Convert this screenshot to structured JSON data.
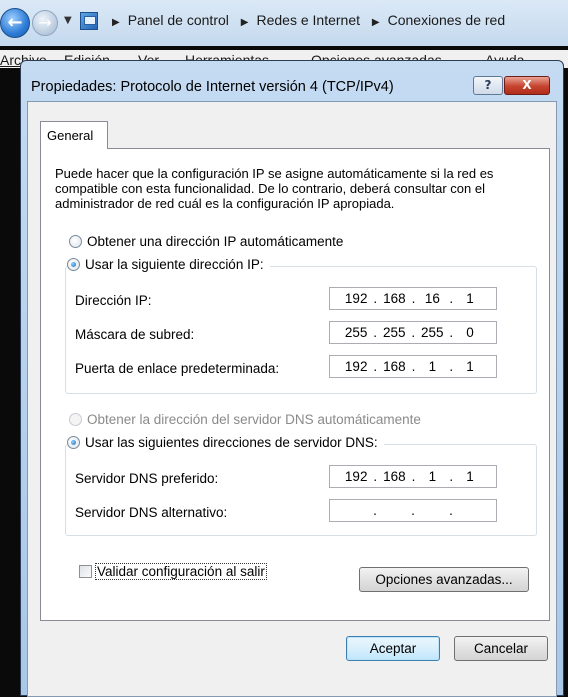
{
  "explorer": {
    "breadcrumbs": [
      "Panel de control",
      "Redes e Internet",
      "Conexiones de red"
    ],
    "menu": [
      "Archivo",
      "Edición",
      "Ver",
      "Herramientas",
      "Opciones avanzadas",
      "Ayuda"
    ]
  },
  "dialog": {
    "title": "Propiedades: Protocolo de Internet versión 4 (TCP/IPv4)",
    "help_glyph": "?",
    "close_glyph": "X",
    "tab": "General",
    "description": "Puede hacer que la configuración IP se asigne automáticamente si la red es compatible con esta funcionalidad. De lo contrario, deberá consultar con el administrador de red cuál es la configuración IP apropiada.",
    "ip_auto_label": "Obtener una dirección IP automáticamente",
    "ip_manual_label": "Usar la siguiente dirección IP:",
    "ip_mode": "manual",
    "ip_address_label": "Dirección IP:",
    "ip_address": [
      "192",
      "168",
      "16",
      "1"
    ],
    "subnet_label": "Máscara de subred:",
    "subnet": [
      "255",
      "255",
      "255",
      "0"
    ],
    "gateway_label": "Puerta de enlace predeterminada:",
    "gateway": [
      "192",
      "168",
      "1",
      "1"
    ],
    "dns_auto_label": "Obtener la dirección del servidor DNS automáticamente",
    "dns_manual_label": "Usar las siguientes direcciones de servidor DNS:",
    "dns_mode": "manual",
    "dns_preferred_label": "Servidor DNS preferido:",
    "dns_preferred": [
      "192",
      "168",
      "1",
      "1"
    ],
    "dns_alternate_label": "Servidor DNS alternativo:",
    "dns_alternate": [
      "",
      "",
      "",
      ""
    ],
    "validate_label": "Validar configuración al salir",
    "validate_checked": false,
    "advanced_button": "Opciones avanzadas...",
    "ok_button": "Aceptar",
    "cancel_button": "Cancelar"
  }
}
